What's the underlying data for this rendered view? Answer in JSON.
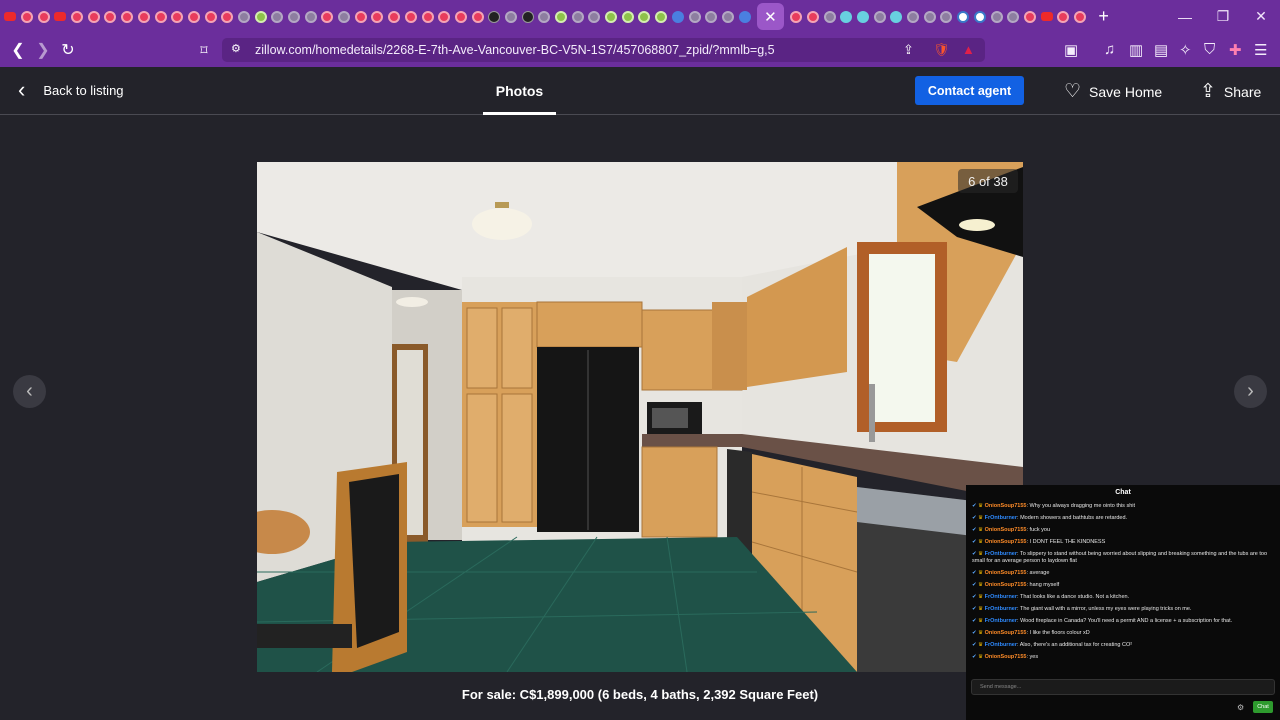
{
  "browser": {
    "url": "zillow.com/homedetails/2268-E-7th-Ave-Vancouver-BC-V5N-1S7/457068807_zpid/?mmlb=g,5",
    "tab_icons": [
      "yt",
      "red",
      "red",
      "yt",
      "red",
      "red",
      "red",
      "red",
      "red",
      "red",
      "red",
      "red",
      "red",
      "red",
      "grey",
      "green",
      "grey",
      "grey",
      "grey",
      "red",
      "grey",
      "red",
      "red",
      "red",
      "red",
      "red",
      "red",
      "red",
      "red",
      "xx",
      "grey",
      "xx",
      "grey",
      "green",
      "grey",
      "grey",
      "green",
      "green",
      "green",
      "green",
      "blue",
      "grey",
      "grey",
      "grey",
      "blue"
    ],
    "tab_icons_right": [
      "red",
      "red",
      "grey",
      "cyan",
      "cyan",
      "grey",
      "cyan",
      "grey",
      "grey",
      "grey",
      "wp",
      "wp",
      "grey",
      "grey",
      "red",
      "yt",
      "red",
      "red"
    ],
    "active_tab_icon": "close-icon",
    "new_tab_label": "+",
    "window_controls": [
      "—",
      "❐",
      "✕"
    ]
  },
  "header": {
    "back_label": "Back to listing",
    "photos_tab": "Photos",
    "contact_label": "Contact agent",
    "save_label": "Save Home",
    "share_label": "Share"
  },
  "photo": {
    "counter": "6 of 38",
    "caption": "For sale: C$1,899,000 (6 beds, 4 baths, 2,392 Square Feet)"
  },
  "chat": {
    "title": "Chat",
    "messages": [
      {
        "user": "OnionSoup7155",
        "type": "u1",
        "text": "Why you always dragging me ointo this shit"
      },
      {
        "user": "FrOntburner",
        "type": "u2",
        "text": "Modern showers and bathtubs are retarded."
      },
      {
        "user": "OnionSoup7155",
        "type": "u1",
        "text": "fuck you"
      },
      {
        "user": "OnionSoup7155",
        "type": "u1",
        "text": "I DONT FEEL THE KINDNESS"
      },
      {
        "user": "FrOntburner",
        "type": "u2",
        "text": "To slippery to stand without being worried about slipping and breaking something and the tubs are too small for an average person to laydown flat"
      },
      {
        "user": "OnionSoup7155",
        "type": "u1",
        "text": "average"
      },
      {
        "user": "OnionSoup7155",
        "type": "u1",
        "text": "hang myself"
      },
      {
        "user": "FrOntburner",
        "type": "u2",
        "text": "That looks like a dance studio. Not a kitchen."
      },
      {
        "user": "FrOntburner",
        "type": "u2",
        "text": "The giant wall with a mirror, unless my eyes were playing tricks on me."
      },
      {
        "user": "FrOntburner",
        "type": "u2",
        "text": "Wood fireplace in Canada? You'll need a permit AND a license + a subscription for that."
      },
      {
        "user": "OnionSoup7155",
        "type": "u1",
        "text": "I like the floors colour xD"
      },
      {
        "user": "FrOntburner",
        "type": "u2",
        "text": "Also, there's an additional tax for creating CO²"
      },
      {
        "user": "OnionSoup7155",
        "type": "u1",
        "text": "yes"
      }
    ],
    "input_placeholder": "Send message...",
    "send_label": "Chat"
  }
}
